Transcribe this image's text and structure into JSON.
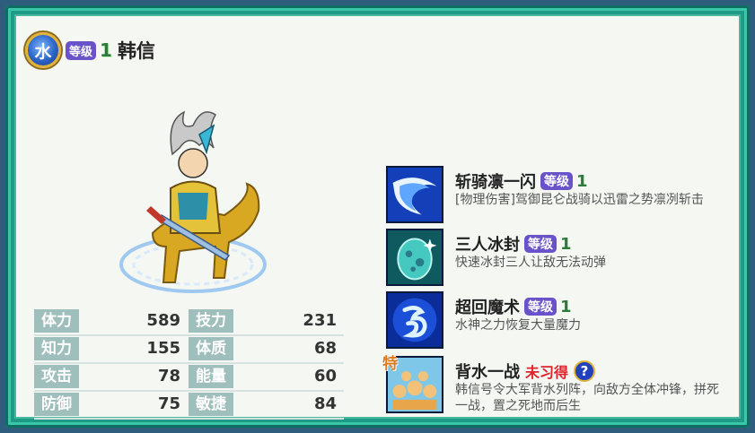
{
  "hero": {
    "element": "水",
    "level_label": "等级",
    "level": "1",
    "name": "韩信",
    "element_icon": "water-element-badge",
    "sprite_icon": "mounted-general-sprite"
  },
  "stats": [
    {
      "label": "体力",
      "value": "589"
    },
    {
      "label": "技力",
      "value": "231"
    },
    {
      "label": "知力",
      "value": "155"
    },
    {
      "label": "体质",
      "value": "68"
    },
    {
      "label": "攻击",
      "value": "78"
    },
    {
      "label": "能量",
      "value": "60"
    },
    {
      "label": "防御",
      "value": "75"
    },
    {
      "label": "敏捷",
      "value": "84"
    }
  ],
  "skills": [
    {
      "name": "斩骑凛一闪",
      "level_label": "等级",
      "level": "1",
      "desc": "[物理伤害]驾御昆仑战骑以迅雷之势凛冽斩击",
      "icon": "slash-wave-icon"
    },
    {
      "name": "三人冰封",
      "level_label": "等级",
      "level": "1",
      "desc": "快速冰封三人让敌无法动弹",
      "icon": "ice-egg-icon"
    },
    {
      "name": "超回魔术",
      "level_label": "等级",
      "level": "1",
      "desc": "水神之力恢复大量魔力",
      "icon": "water-rune-icon"
    },
    {
      "name": "背水一战",
      "status": "未习得",
      "special_tag": "特",
      "help": "?",
      "desc": "韩信号令大军背水列阵，向敌方全体冲锋，拼死一战，置之死地而后生",
      "icon": "army-crowd-icon"
    }
  ],
  "colors": {
    "frame": "#1f9a86",
    "panel": "#f4f7f2",
    "level_badge": "#6a52c9",
    "stat_label": "#9fbfbd",
    "unlearned": "#e0222a"
  }
}
